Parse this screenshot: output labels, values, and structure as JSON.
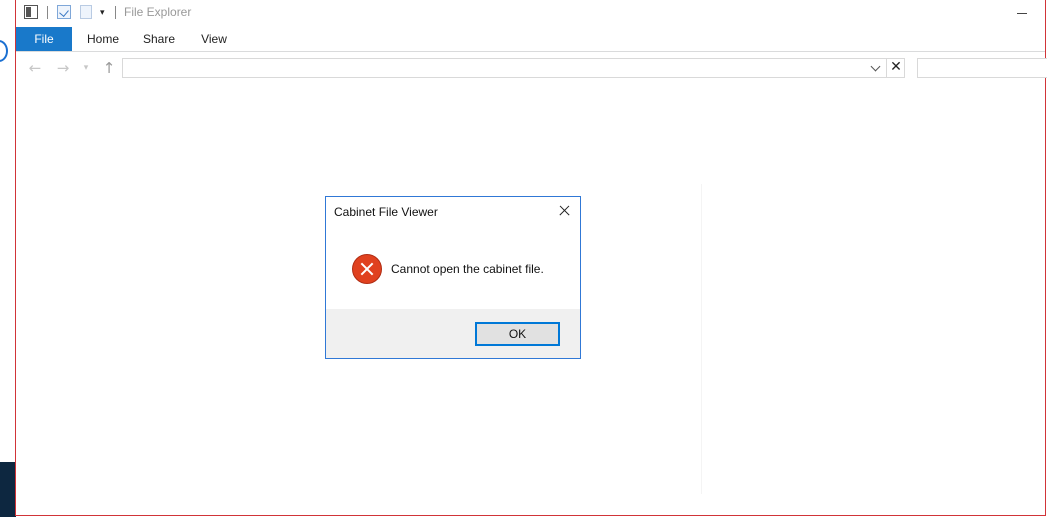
{
  "window": {
    "title": "File Explorer"
  },
  "quick_access": {
    "icons": [
      "properties-icon",
      "checkmark-document-icon",
      "blank-document-icon",
      "customize-dropdown-icon"
    ],
    "dropdown_glyph": "▾"
  },
  "ribbon": {
    "tabs": [
      {
        "label": "File",
        "active": true
      },
      {
        "label": "Home"
      },
      {
        "label": "Share"
      },
      {
        "label": "View"
      }
    ]
  },
  "navigation": {
    "back_glyph": "←",
    "forward_glyph": "→",
    "recent_glyph": "▾",
    "up_glyph": "↑",
    "address_value": "",
    "clear_glyph": "✕",
    "search_value": ""
  },
  "dialog": {
    "title": "Cabinet File Viewer",
    "message": "Cannot open the cabinet file.",
    "ok_label": "OK",
    "icon": "error-icon"
  },
  "colors": {
    "accent": "#1979ca",
    "window_border": "#d13438",
    "dialog_border": "#3078d6",
    "error": "#e0411f"
  }
}
